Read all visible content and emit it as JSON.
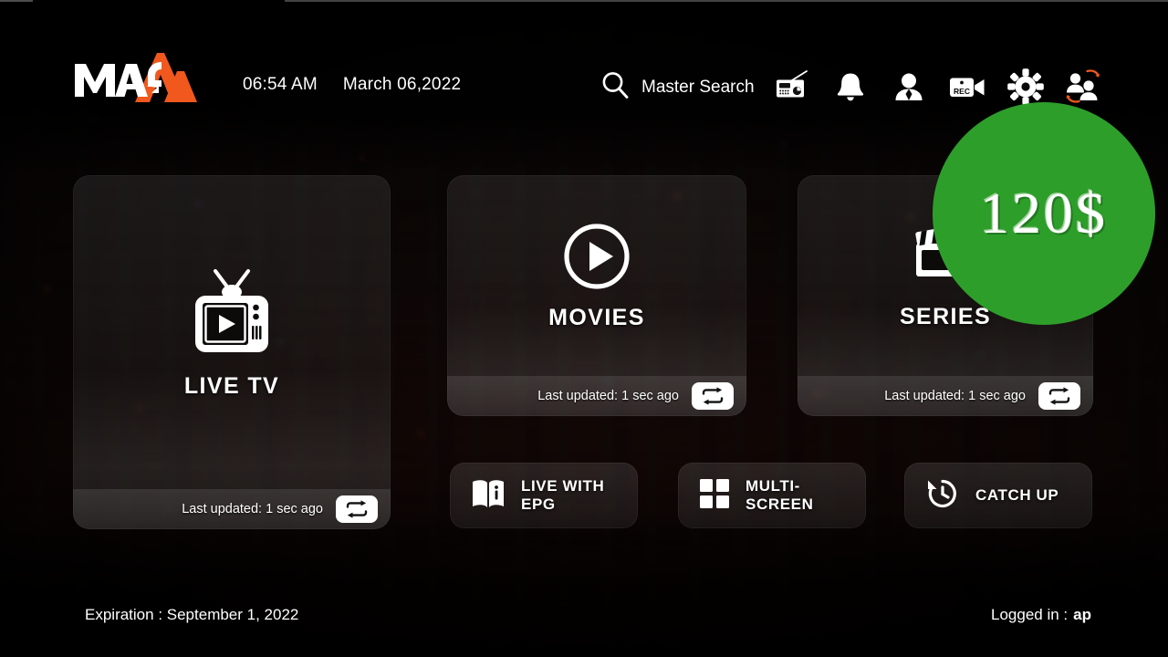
{
  "app": {
    "logo_text": "MAG",
    "accent_color": "#F0581E",
    "badge_color": "#2E9E2A",
    "background_color": "#000000"
  },
  "header": {
    "time": "06:54 AM",
    "date": "March 06,2022",
    "search": {
      "label": "Master Search",
      "icon": "search-icon"
    },
    "icons": [
      {
        "name": "radio-icon",
        "label": "Radio"
      },
      {
        "name": "bell-icon",
        "label": "Notifications"
      },
      {
        "name": "user-icon",
        "label": "Account"
      },
      {
        "name": "rec-camera-icon",
        "label": "REC"
      },
      {
        "name": "gear-icon",
        "label": "Settings"
      },
      {
        "name": "switch-user-icon",
        "label": "Switch User"
      }
    ]
  },
  "price_badge": {
    "text": "120$"
  },
  "tiles": [
    {
      "id": "livetv",
      "label": "LIVE TV",
      "icon": "tv-play-icon",
      "updated": "Last updated: 1 sec ago",
      "refresh_icon": "refresh-loop-icon"
    },
    {
      "id": "movies",
      "label": "MOVIES",
      "icon": "play-circle-icon",
      "updated": "Last updated: 1 sec ago",
      "refresh_icon": "refresh-loop-icon"
    },
    {
      "id": "series",
      "label": "SERIES",
      "icon": "clapperboard-icon",
      "updated": "Last updated: 1 sec ago",
      "refresh_icon": "refresh-loop-icon"
    }
  ],
  "actions": [
    {
      "id": "epg",
      "label": "LIVE WITH EPG",
      "icon": "book-info-icon"
    },
    {
      "id": "multi",
      "label": "MULTI-SCREEN",
      "icon": "grid-four-icon"
    },
    {
      "id": "catchup",
      "label": "CATCH UP",
      "icon": "clock-rewind-icon"
    }
  ],
  "footer": {
    "expiration": "Expiration : September 1, 2022",
    "logged_in_label": "Logged in :",
    "logged_in_user": "ap"
  }
}
